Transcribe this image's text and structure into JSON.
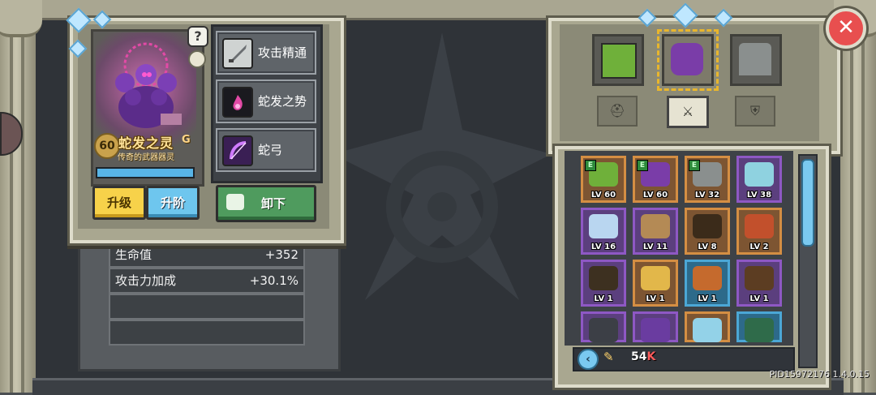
{
  "character": {
    "level": "60",
    "name": "蛇发之灵",
    "grade": "G",
    "subtitle": "传奇的武器器灵",
    "xp_fraction": 1.0,
    "help_label": "?"
  },
  "skills": [
    {
      "label": "攻击精通",
      "icon": "sword-mastery-icon"
    },
    {
      "label": "蛇发之势",
      "icon": "pink-flame-icon"
    },
    {
      "label": "蛇弓",
      "icon": "snake-bow-icon"
    }
  ],
  "buttons": {
    "upgrade": "升级",
    "advance": "升阶",
    "unequip": "卸下",
    "close": "✕"
  },
  "stats": [
    {
      "name": "生命值",
      "value": "+352"
    },
    {
      "name": "攻击力加成",
      "value": "+30.1%"
    },
    {
      "name": "",
      "value": ""
    },
    {
      "name": "",
      "value": ""
    }
  ],
  "category_tabs": [
    {
      "icon": "helmet-icon",
      "glyph": "⛑"
    },
    {
      "icon": "weapon-icon",
      "glyph": "⚔"
    },
    {
      "icon": "shield-icon",
      "glyph": "⛨"
    }
  ],
  "inventory": [
    {
      "lv": "LV 60",
      "tag": "E",
      "frame": "#d48e43",
      "art": "#6fb03a",
      "bg": "#7d5532"
    },
    {
      "lv": "LV 60",
      "tag": "E",
      "frame": "#d48e43",
      "art": "#7a3da8",
      "bg": "#7d5532"
    },
    {
      "lv": "LV 32",
      "tag": "E",
      "frame": "#d48e43",
      "art": "#8a8f8e",
      "bg": "#7d5532"
    },
    {
      "lv": "LV 38",
      "tag": "",
      "frame": "#8e58c4",
      "art": "#8fd2e0",
      "bg": "#5b3f7e"
    },
    {
      "lv": "LV 16",
      "tag": "",
      "frame": "#8e58c4",
      "art": "#b9d6f0",
      "bg": "#5b3f7e"
    },
    {
      "lv": "LV 11",
      "tag": "",
      "frame": "#8e58c4",
      "art": "#b48a55",
      "bg": "#5b3f7e"
    },
    {
      "lv": "LV 8",
      "tag": "",
      "frame": "#d48e43",
      "art": "#3b2b1a",
      "bg": "#7d5532"
    },
    {
      "lv": "LV 2",
      "tag": "",
      "frame": "#d48e43",
      "art": "#c2502c",
      "bg": "#7d5532"
    },
    {
      "lv": "LV 1",
      "tag": "",
      "frame": "#8e58c4",
      "art": "#3d3020",
      "bg": "#5b3f7e"
    },
    {
      "lv": "LV 1",
      "tag": "",
      "frame": "#d48e43",
      "art": "#e2b74a",
      "bg": "#7d5532"
    },
    {
      "lv": "LV 1",
      "tag": "",
      "frame": "#4ba7d6",
      "art": "#c56a2d",
      "bg": "#2d6a8a"
    },
    {
      "lv": "LV 1",
      "tag": "",
      "frame": "#8e58c4",
      "art": "#5c3d22",
      "bg": "#5b3f7e"
    },
    {
      "lv": "",
      "tag": "",
      "frame": "#8e58c4",
      "art": "#3c3f46",
      "bg": "#5b3f7e"
    },
    {
      "lv": "",
      "tag": "",
      "frame": "#8e58c4",
      "art": "#6a3ca0",
      "bg": "#5b3f7e"
    },
    {
      "lv": "",
      "tag": "",
      "frame": "#d48e43",
      "art": "#93d2e8",
      "bg": "#7d5532"
    },
    {
      "lv": "",
      "tag": "",
      "frame": "#4ba7d6",
      "art": "#2f6b4a",
      "bg": "#2d6a8a"
    }
  ],
  "footer": {
    "back": "‹",
    "pin": "✎",
    "coins": "54",
    "coins_unit": "K"
  },
  "build": "PID15972176  1.4.0.15"
}
